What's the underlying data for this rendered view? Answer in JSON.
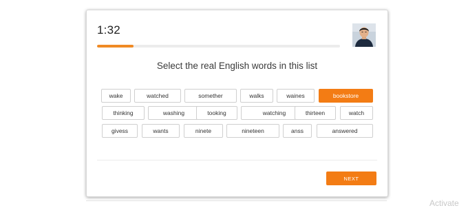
{
  "quiz": {
    "timer": "1:32",
    "progress_fraction": 0.15,
    "prompt": "Select the real English words in this list",
    "next_label": "NEXT",
    "accent_color": "#f37c14",
    "words": [
      [
        {
          "label": "wake",
          "selected": false
        },
        {
          "label": "watched",
          "selected": false
        },
        {
          "label": "somether",
          "selected": false
        },
        {
          "label": "walks",
          "selected": false
        },
        {
          "label": "waines",
          "selected": false
        },
        {
          "label": "bookstore",
          "selected": true
        }
      ],
      [
        {
          "label": "thinking",
          "selected": false
        },
        {
          "label": "washing",
          "selected": false
        },
        {
          "label": "tooking",
          "selected": false
        },
        {
          "label": "watching",
          "selected": false
        },
        {
          "label": "thirteen",
          "selected": false
        },
        {
          "label": "watch",
          "selected": false
        }
      ],
      [
        {
          "label": "givess",
          "selected": false
        },
        {
          "label": "wants",
          "selected": false
        },
        {
          "label": "ninete",
          "selected": false
        },
        {
          "label": "nineteen",
          "selected": false
        },
        {
          "label": "anss",
          "selected": false
        },
        {
          "label": "answered",
          "selected": false
        }
      ]
    ]
  },
  "avatar": {
    "icon": "user-photo"
  },
  "watermark": "Activate"
}
